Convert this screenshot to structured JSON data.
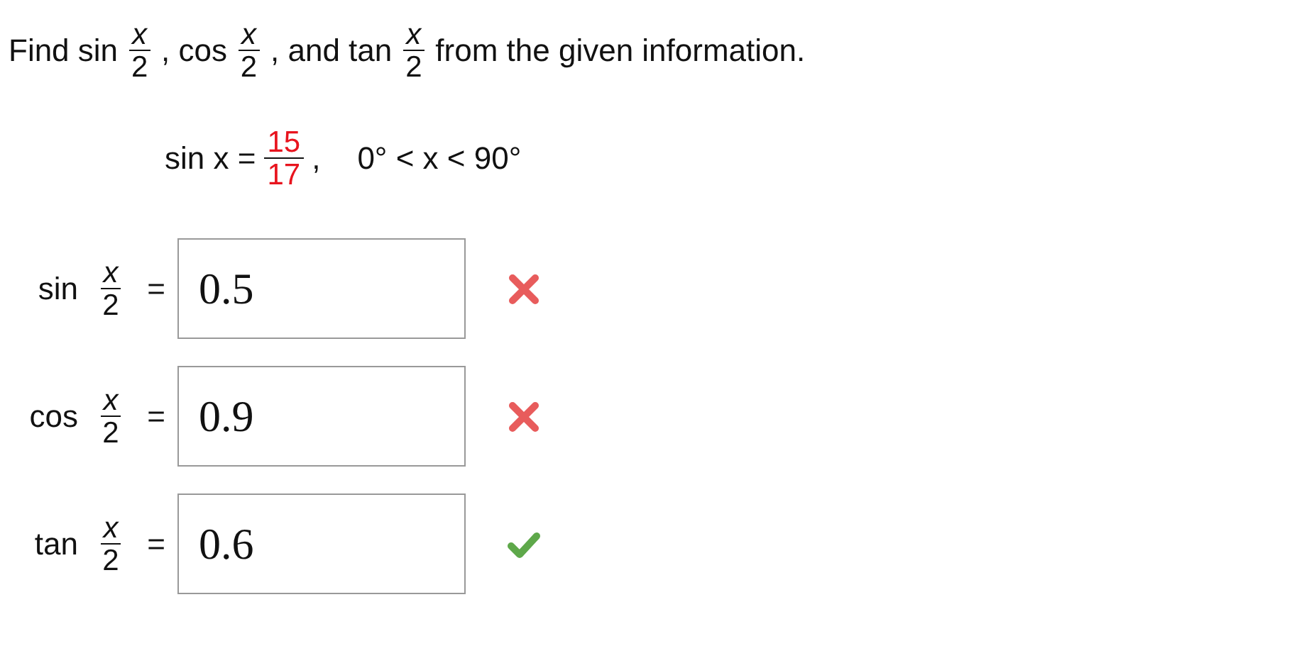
{
  "prompt": [
    {
      "kind": "text",
      "text": "Find sin"
    },
    {
      "kind": "frac",
      "num": "x",
      "den": "2"
    },
    {
      "kind": "text",
      "text": ", cos"
    },
    {
      "kind": "frac",
      "num": "x",
      "den": "2"
    },
    {
      "kind": "text",
      "text": ", and tan"
    },
    {
      "kind": "frac",
      "num": "x",
      "den": "2"
    },
    {
      "kind": "text",
      "text": "from the given information."
    }
  ],
  "given": {
    "lhs": "sin x =",
    "num": "15",
    "den": "17",
    "sep": ",",
    "condition": "0° < x < 90°"
  },
  "answers": [
    {
      "func": "sin",
      "num": "x",
      "den": "2",
      "eq": "=",
      "value": "0.5",
      "correct": false
    },
    {
      "func": "cos",
      "num": "x",
      "den": "2",
      "eq": "=",
      "value": "0.9",
      "correct": false
    },
    {
      "func": "tan",
      "num": "x",
      "den": "2",
      "eq": "=",
      "value": "0.6",
      "correct": true
    }
  ]
}
